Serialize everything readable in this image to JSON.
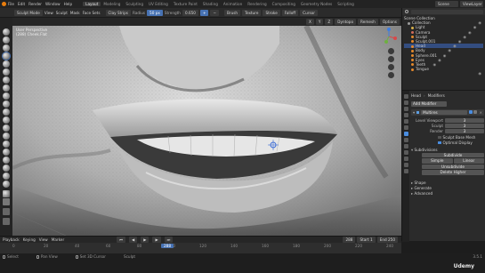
{
  "topbar": {
    "menu": [
      "File",
      "Edit",
      "Render",
      "Window",
      "Help"
    ],
    "tabs": [
      "Layout",
      "Modeling",
      "Sculpting",
      "UV Editing",
      "Texture Paint",
      "Shading",
      "Animation",
      "Rendering",
      "Compositing",
      "Geometry Nodes",
      "Scripting"
    ],
    "active_tab": "Layout",
    "scene_label": "Scene",
    "view_layer_label": "ViewLayer"
  },
  "toolheader": {
    "mode": "Sculpt Mode",
    "menus": [
      "View",
      "Sculpt",
      "Mask",
      "Face Sets"
    ],
    "brush_name": "Clay Strips",
    "radius_label": "Radius",
    "radius_value": "50 px",
    "strength_label": "Strength",
    "strength_value": "0.650",
    "add_label": "+",
    "sub_label": "−",
    "dropdowns": [
      "Brush",
      "Texture",
      "Stroke",
      "Falloff",
      "Cursor"
    ],
    "right_chips": [
      "Dyntopo",
      "Remesh",
      "Options"
    ]
  },
  "viewport": {
    "info_line1": "User Perspective",
    "info_line2": "(288) Cheek.Flat",
    "colors": {
      "skin_light": "#d6d6d6",
      "skin_mid": "#a8a8a8",
      "skin_dark": "#5a5a5a",
      "cursor": "#3d6dd6"
    }
  },
  "outliner": {
    "header": "Scene Collection",
    "items": [
      {
        "label": "Collection",
        "depth": 1,
        "selected": false,
        "color": "#9c9c9c"
      },
      {
        "label": "Light",
        "depth": 2,
        "selected": false,
        "color": "#d8b04a"
      },
      {
        "label": "Camera",
        "depth": 2,
        "selected": false,
        "color": "#d06a5a"
      },
      {
        "label": "Sculpt",
        "depth": 2,
        "selected": false,
        "color": "#e58a2c"
      },
      {
        "label": "Sculpt.001",
        "depth": 2,
        "selected": false,
        "color": "#e58a2c"
      },
      {
        "label": "Head",
        "depth": 2,
        "selected": true,
        "color": "#e58a2c"
      },
      {
        "label": "Body",
        "depth": 2,
        "selected": false,
        "color": "#e58a2c"
      },
      {
        "label": "Sphere.001",
        "depth": 2,
        "selected": false,
        "color": "#e58a2c"
      },
      {
        "label": "Eyes",
        "depth": 2,
        "selected": false,
        "color": "#e58a2c"
      },
      {
        "label": "Teeth",
        "depth": 2,
        "selected": false,
        "color": "#e58a2c"
      },
      {
        "label": "Tongue",
        "depth": 2,
        "selected": false,
        "color": "#e58a2c"
      }
    ]
  },
  "properties": {
    "object_name": "Head",
    "breadcrumb": "Modifiers",
    "add_modifier": "Add Modifier",
    "modifier_name": "Multires",
    "fields": [
      {
        "label": "Level Viewport",
        "value": "3"
      },
      {
        "label": "Sculpt",
        "value": "3"
      },
      {
        "label": "Render",
        "value": "3"
      }
    ],
    "sculpt_base_mesh": "Sculpt Base Mesh",
    "optimal_display": "Optimal Display",
    "subdivisions_label": "Subdivisions",
    "buttons": [
      "Subdivide",
      "Simple",
      "Linear",
      "Unsubdivide",
      "Delete Higher"
    ],
    "sections": [
      "Shape",
      "Generate",
      "Advanced"
    ]
  },
  "timeline": {
    "menus": [
      "Playback",
      "Keying",
      "View",
      "Marker"
    ],
    "current_frame": "288",
    "start_label": "Start",
    "start_value": "1",
    "end_label": "End",
    "end_value": "250",
    "ticks": [
      "0",
      "20",
      "40",
      "60",
      "80",
      "100",
      "120",
      "140",
      "160",
      "180",
      "200",
      "220",
      "240"
    ],
    "playhead_frame": 288
  },
  "statusbar": {
    "left": "Select",
    "mid1": "Pan View",
    "mid2": "Set 3D Cursor",
    "mid3": "Sculpt",
    "version": "3.5.1"
  },
  "watermark": "Udemy"
}
